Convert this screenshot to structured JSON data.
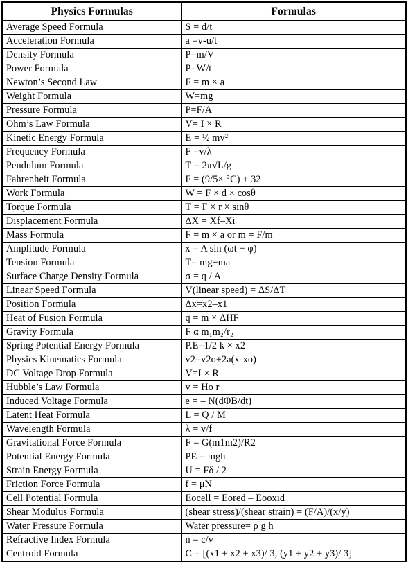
{
  "table": {
    "headers": {
      "name": "Physics Formulas",
      "formula": "Formulas"
    },
    "rows": [
      {
        "name": "Average Speed Formula",
        "formula": "S = d/t"
      },
      {
        "name": "Acceleration Formula",
        "formula": "a =v-u/t"
      },
      {
        "name": "Density Formula",
        "formula": "P=m/V"
      },
      {
        "name": "Power Formula",
        "formula": "P=W/t"
      },
      {
        "name": "Newton’s Second Law",
        "formula": "F = m × a"
      },
      {
        "name": "Weight Formula",
        "formula": "W=mg"
      },
      {
        "name": "Pressure Formula",
        "formula": "P=F/A"
      },
      {
        "name": "Ohm’s Law Formula",
        "formula": "V= I × R"
      },
      {
        "name": "Kinetic Energy Formula",
        "formula": "E = ½ mv²"
      },
      {
        "name": "Frequency Formula",
        "formula": "F =v/λ"
      },
      {
        "name": "Pendulum Formula",
        "formula": "T = 2π√L/g"
      },
      {
        "name": "Fahrenheit Formula",
        "formula": "F = (9/5× °C) + 32"
      },
      {
        "name": "Work Formula",
        "formula": "W = F × d × cosθ"
      },
      {
        "name": "Torque Formula",
        "formula": "T = F × r × sinθ"
      },
      {
        "name": "Displacement Formula",
        "formula": "ΔX = Xf–Xi"
      },
      {
        "name": "Mass Formula",
        "formula": "F = m × a or m = F/m"
      },
      {
        "name": "Amplitude Formula",
        "formula": "x = A sin (ωt + φ)"
      },
      {
        "name": "Tension Formula",
        "formula": "T= mg+ma"
      },
      {
        "name": "Surface Charge Density Formula",
        "formula": "σ = q / A"
      },
      {
        "name": "Linear Speed Formula",
        "formula": "V(linear speed) = ΔS/ΔT"
      },
      {
        "name": "Position Formula",
        "formula": "Δx=x2–x1"
      },
      {
        "name": "Heat of Fusion Formula",
        "formula": "q = m × ΔHF"
      },
      {
        "name": "Gravity Formula",
        "formula": "F α m₁m₂/r₂"
      },
      {
        "name": "Spring Potential Energy Formula",
        "formula": "P.E=1/2 k × x2"
      },
      {
        "name": "Physics Kinematics Formula",
        "formula": "v2=v2o+2a(x-xo)"
      },
      {
        "name": "DC Voltage Drop Formula",
        "formula": "V=I ×  R"
      },
      {
        "name": "Hubble’s Law Formula",
        "formula": "v = Ho r"
      },
      {
        "name": "Induced Voltage Formula",
        "formula": "e = – N(dΦB/dt)"
      },
      {
        "name": "Latent Heat Formula",
        "formula": "L = Q / M"
      },
      {
        "name": "Wavelength Formula",
        "formula": "λ = v/f"
      },
      {
        "name": "Gravitational Force Formula",
        "formula": "F = G(m1m2)/R2"
      },
      {
        "name": "Potential Energy Formula",
        "formula": "PE = mgh"
      },
      {
        "name": "Strain Energy Formula",
        "formula": "U = Fδ / 2"
      },
      {
        "name": "Friction Force Formula",
        "formula": "f = μN"
      },
      {
        "name": "Cell Potential Formula",
        "formula": "Eocell = Eored – Eooxid"
      },
      {
        "name": "Shear Modulus Formula",
        "formula": "(shear stress)/(shear strain) = (F/A)/(x/y)"
      },
      {
        "name": "Water Pressure Formula",
        "formula": "Water pressure= ρ g h"
      },
      {
        "name": "Refractive Index Formula",
        "formula": "n = c/v"
      },
      {
        "name": "Centroid Formula",
        "formula": "C = [(x1 + x2 + x3)/ 3, (y1 + y2 + y3)/ 3]"
      }
    ]
  },
  "colors": {
    "border": "#000000",
    "text": "#000000",
    "background": "#ffffff"
  }
}
